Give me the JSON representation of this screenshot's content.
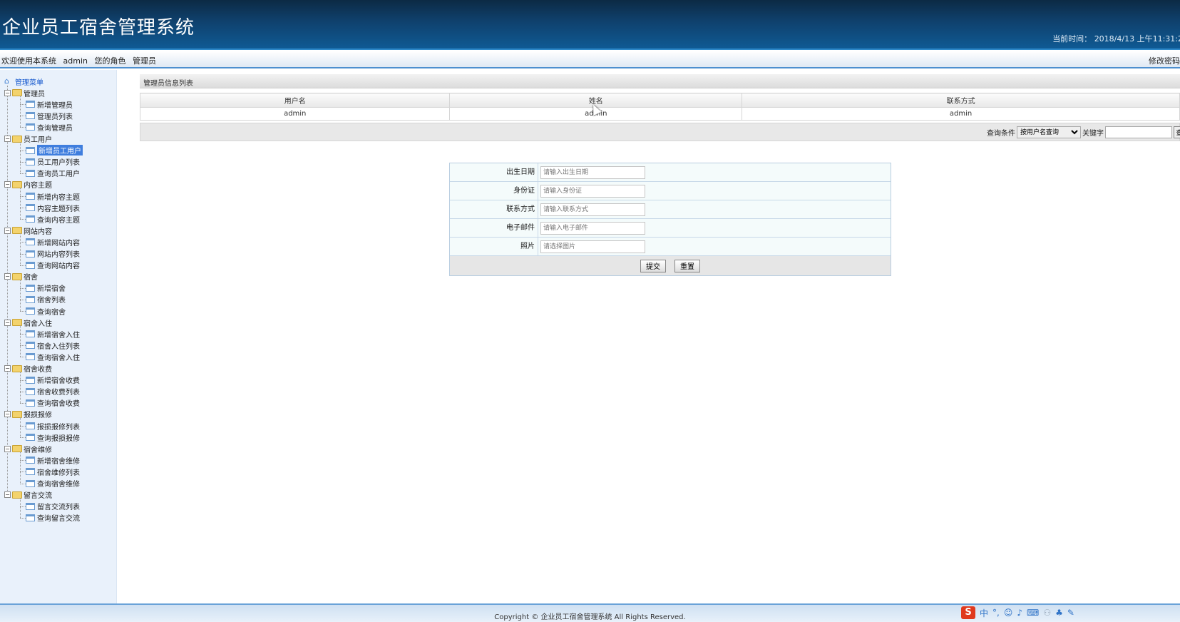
{
  "header": {
    "title": "企业员工宿舍管理系统",
    "time_label": "当前时间：",
    "time_value": "2018/4/13 上午11:31:2"
  },
  "welcome": {
    "text": "欢迎使用本系统",
    "user": "admin",
    "role_label": "您的角色",
    "role": "管理员",
    "change_password": "修改密码"
  },
  "sidebar": {
    "root": "管理菜单",
    "groups": [
      {
        "label": "管理员",
        "items": [
          "新增管理员",
          "管理员列表",
          "查询管理员"
        ]
      },
      {
        "label": "员工用户",
        "items": [
          "新增员工用户",
          "员工用户列表",
          "查询员工用户"
        ]
      },
      {
        "label": "内容主题",
        "items": [
          "新增内容主题",
          "内容主题列表",
          "查询内容主题"
        ]
      },
      {
        "label": "网站内容",
        "items": [
          "新增网站内容",
          "网站内容列表",
          "查询网站内容"
        ]
      },
      {
        "label": "宿舍",
        "items": [
          "新增宿舍",
          "宿舍列表",
          "查询宿舍"
        ]
      },
      {
        "label": "宿舍入住",
        "items": [
          "新增宿舍入住",
          "宿舍入住列表",
          "查询宿舍入住"
        ]
      },
      {
        "label": "宿舍收费",
        "items": [
          "新增宿舍收费",
          "宿舍收费列表",
          "查询宿舍收费"
        ]
      },
      {
        "label": "报损报修",
        "items": [
          "报损报修列表",
          "查询报损报修"
        ]
      },
      {
        "label": "宿舍维修",
        "items": [
          "新增宿舍维修",
          "宿舍维修列表",
          "查询宿舍维修"
        ]
      },
      {
        "label": "留言交流",
        "items": [
          "留言交流列表",
          "查询留言交流"
        ]
      }
    ],
    "selected": "新增员工用户"
  },
  "list": {
    "title": "管理员信息列表",
    "columns": [
      "用户名",
      "姓名",
      "联系方式"
    ],
    "rows": [
      [
        "admin",
        "admin",
        "admin"
      ]
    ]
  },
  "query": {
    "condition_label": "查询条件",
    "condition_value": "按用户名查询",
    "keyword_label": "关键字",
    "search_button": "查"
  },
  "form": {
    "fields": [
      {
        "label": "出生日期",
        "placeholder": "请输入出生日期"
      },
      {
        "label": "身份证",
        "placeholder": "请输入身份证"
      },
      {
        "label": "联系方式",
        "placeholder": "请输入联系方式"
      },
      {
        "label": "电子邮件",
        "placeholder": "请输入电子邮件"
      },
      {
        "label": "照片",
        "placeholder": "请选择图片"
      }
    ],
    "submit": "提交",
    "reset": "重置"
  },
  "footer": {
    "copyright": "Copyright © 企业员工宿舍管理系统 All Rights Reserved."
  },
  "ime": {
    "logo": "S",
    "mode": "中",
    "icons": [
      "punctuation-icon",
      "emoji-icon",
      "microphone-icon",
      "keyboard-icon",
      "user-icon",
      "skin-icon",
      "tools-icon"
    ]
  }
}
